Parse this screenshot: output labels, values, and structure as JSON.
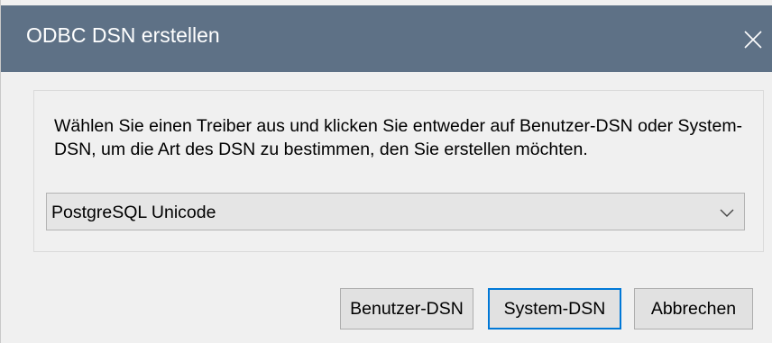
{
  "window": {
    "title": "ODBC DSN erstellen",
    "close_icon": "close-icon"
  },
  "group": {
    "description": "Wählen Sie einen Treiber aus und klicken Sie entweder auf Benutzer-DSN oder System-DSN, um die Art des DSN zu bestimmen, den Sie erstellen möchten."
  },
  "driver_select": {
    "value": "PostgreSQL Unicode",
    "dropdown_icon": "chevron-down-icon"
  },
  "buttons": {
    "user_dsn": "Benutzer-DSN",
    "system_dsn": "System-DSN",
    "cancel": "Abbrechen"
  },
  "colors": {
    "titlebar": "#5e7186",
    "focus_border": "#0078d7",
    "dialog_background": "#f0f0f0"
  }
}
